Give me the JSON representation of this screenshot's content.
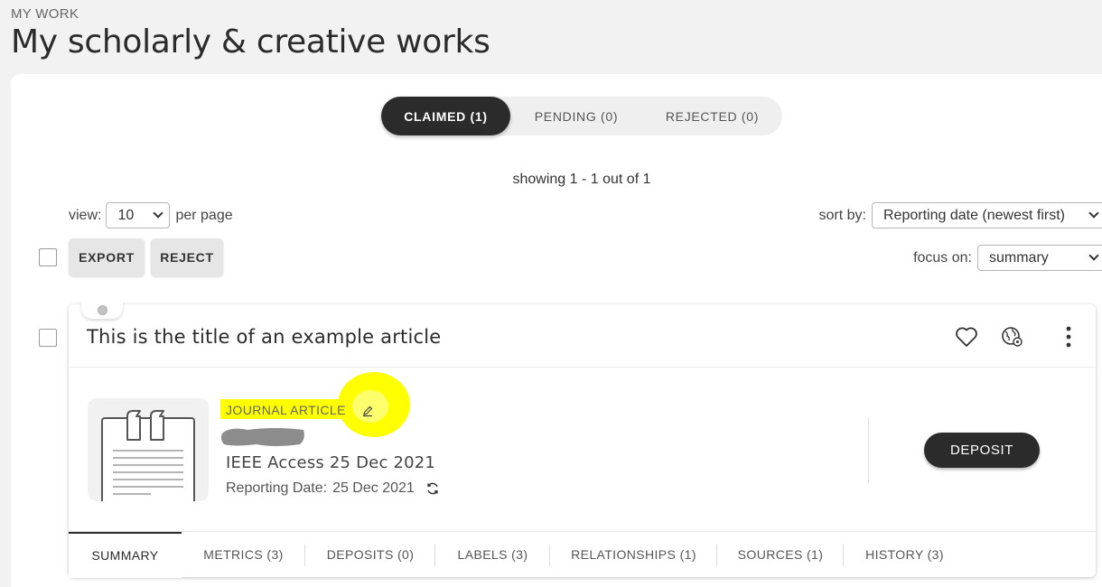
{
  "header": {
    "eyebrow": "MY WORK",
    "title": "My scholarly & creative works"
  },
  "status_tabs": [
    {
      "label": "CLAIMED (1)",
      "active": true
    },
    {
      "label": "PENDING (0)",
      "active": false
    },
    {
      "label": "REJECTED (0)",
      "active": false
    }
  ],
  "showing": "showing 1 - 1 out of 1",
  "view": {
    "label": "view:",
    "value": "10",
    "suffix": "per page"
  },
  "sort": {
    "label": "sort by:",
    "value": "Reporting date (newest first)"
  },
  "focus": {
    "label": "focus on:",
    "value": "summary"
  },
  "bulk_actions": {
    "export_label": "EXPORT",
    "reject_label": "REJECT"
  },
  "card": {
    "title": "This is the title of an example article",
    "type_label": "JOURNAL ARTICLE",
    "venue": "IEEE Access 25 Dec 2021",
    "reporting_label": "Reporting Date:",
    "reporting_date": "25 Dec 2021",
    "deposit_label": "DEPOSIT",
    "header_icons": [
      "heart-icon",
      "globe-settings-icon",
      "kebab-menu-icon"
    ],
    "tabs": [
      {
        "label": "SUMMARY",
        "active": true
      },
      {
        "label": "METRICS (3)",
        "active": false
      },
      {
        "label": "DEPOSITS (0)",
        "active": false
      },
      {
        "label": "LABELS (3)",
        "active": false
      },
      {
        "label": "RELATIONSHIPS (1)",
        "active": false
      },
      {
        "label": "SOURCES (1)",
        "active": false
      },
      {
        "label": "HISTORY (3)",
        "active": false
      }
    ]
  },
  "colors": {
    "primary_dark": "#2b2b2b",
    "background": "#f2f2f2",
    "highlight": "#ffff00",
    "redaction": "#8c8c8c"
  }
}
